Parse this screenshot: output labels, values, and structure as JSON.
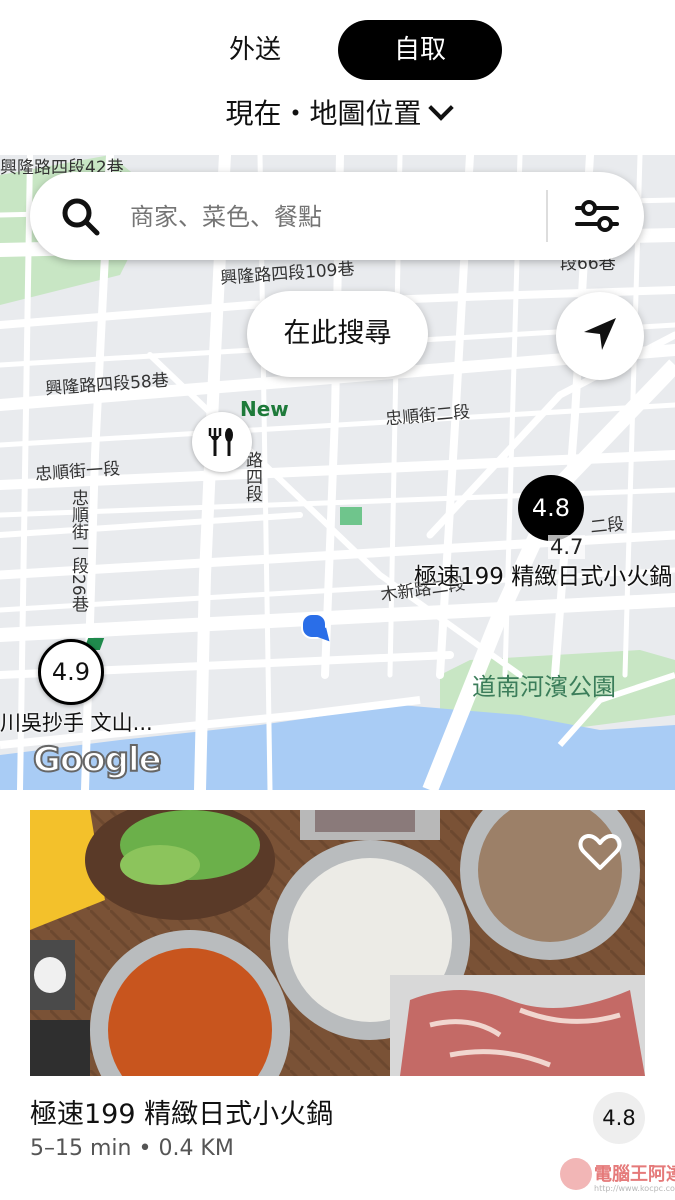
{
  "mode_tabs": [
    {
      "label": "外送",
      "active": false
    },
    {
      "label": "自取",
      "active": true
    }
  ],
  "location": {
    "label": "現在・地圖位置"
  },
  "search": {
    "placeholder": "商家、菜色、餐點"
  },
  "map": {
    "search_here_label": "在此搜尋",
    "new_badge": "New",
    "road_labels": [
      "興隆路四段42巷",
      "興隆路四段109巷",
      "興隆路四段58巷",
      "忠順街二段",
      "忠順街一段",
      "忠順街一段26巷",
      "木新路二段",
      "二段",
      "段66巷",
      "路四段"
    ],
    "park_label": "道南河濱公園",
    "pins": [
      {
        "rating": "4.8",
        "style": "selected"
      },
      {
        "rating": "4.7",
        "style": "small"
      },
      {
        "rating": "4.9",
        "style": "outline"
      }
    ],
    "store_labels": [
      "極速199 精緻日式小火鍋",
      "川吳抄手 文山..."
    ],
    "attribution": "Google"
  },
  "store_card": {
    "name": "極速199 精緻日式小火鍋",
    "eta": "5–15 min",
    "distance": "0.4 KM",
    "rating": "4.8",
    "favorited": false
  },
  "watermark": {
    "text": "電腦王阿達",
    "url": "http://www.kocpc.com.tw"
  },
  "colors": {
    "accent_black": "#000000",
    "park_green": "#c8e6c4",
    "water_blue": "#a9ccf5",
    "map_road": "#ffffff",
    "map_block": "#e9ebee"
  }
}
